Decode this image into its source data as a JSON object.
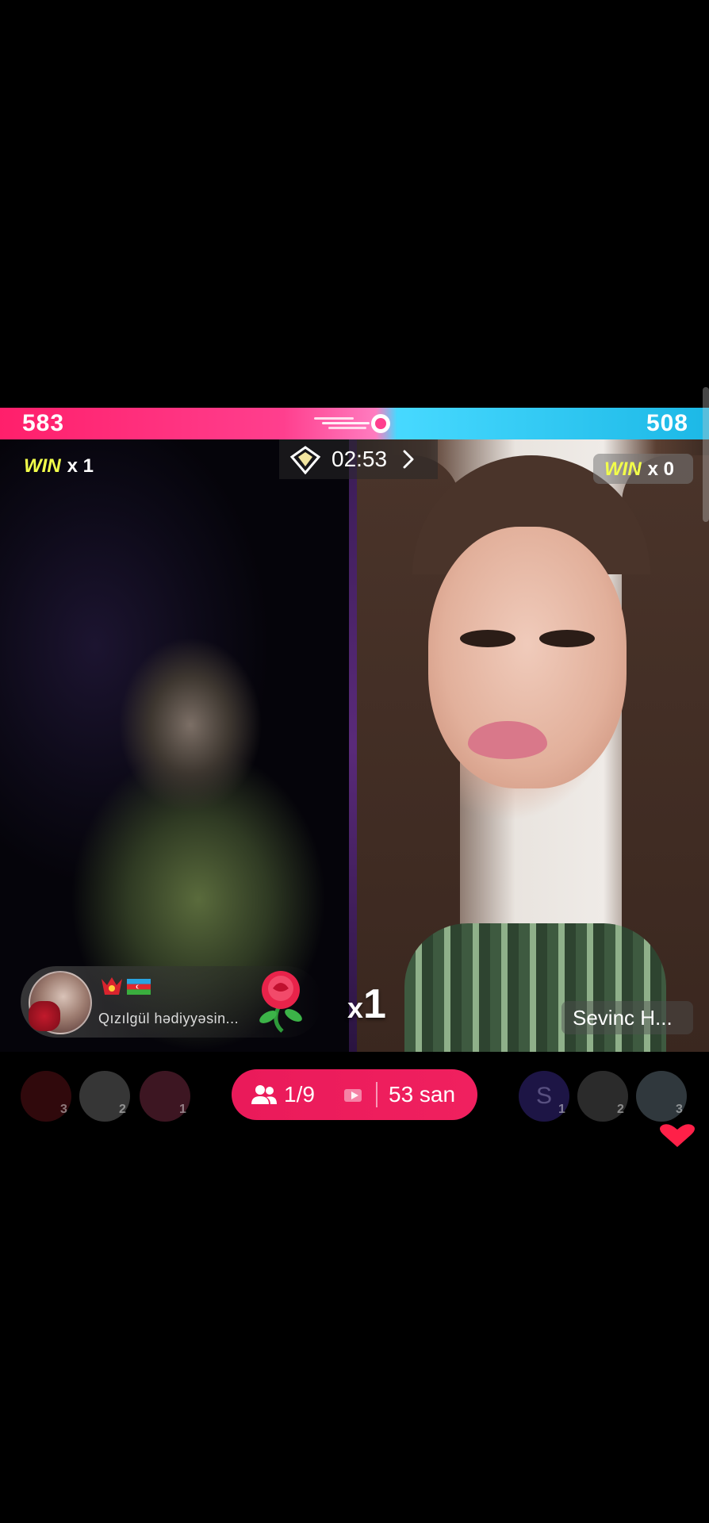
{
  "battle": {
    "left_score": "583",
    "right_score": "508",
    "timer": "02:53",
    "left_team": {
      "win_label": "WIN",
      "win_count": "x 1"
    },
    "right_team": {
      "win_label": "WIN",
      "win_count": "x 0"
    }
  },
  "gift_notification": {
    "text": "Qızılgül  hədiyyəsin...",
    "multiplier_x": "x",
    "multiplier_n": "1",
    "gift_icon": "rose-icon"
  },
  "streamer": {
    "name": "Sevinc H..."
  },
  "center_pill": {
    "viewer_progress": "1/9",
    "seconds": "53 san"
  },
  "left_ranking": [
    {
      "rank": "3",
      "color": "#8a1a22"
    },
    {
      "rank": "2",
      "color": "#9a9a9a"
    },
    {
      "rank": "1",
      "color": "#b04060"
    }
  ],
  "right_ranking": [
    {
      "rank": "1",
      "letter": "S",
      "color": "#3a2a8a"
    },
    {
      "rank": "2",
      "color": "#7a7a7a"
    },
    {
      "rank": "3",
      "color": "#8aa0b0"
    }
  ],
  "colors": {
    "left_team": "#ff1f6b",
    "right_team": "#1cb8e6",
    "pill": "#ea1a5a",
    "win": "#f2ff4a"
  }
}
